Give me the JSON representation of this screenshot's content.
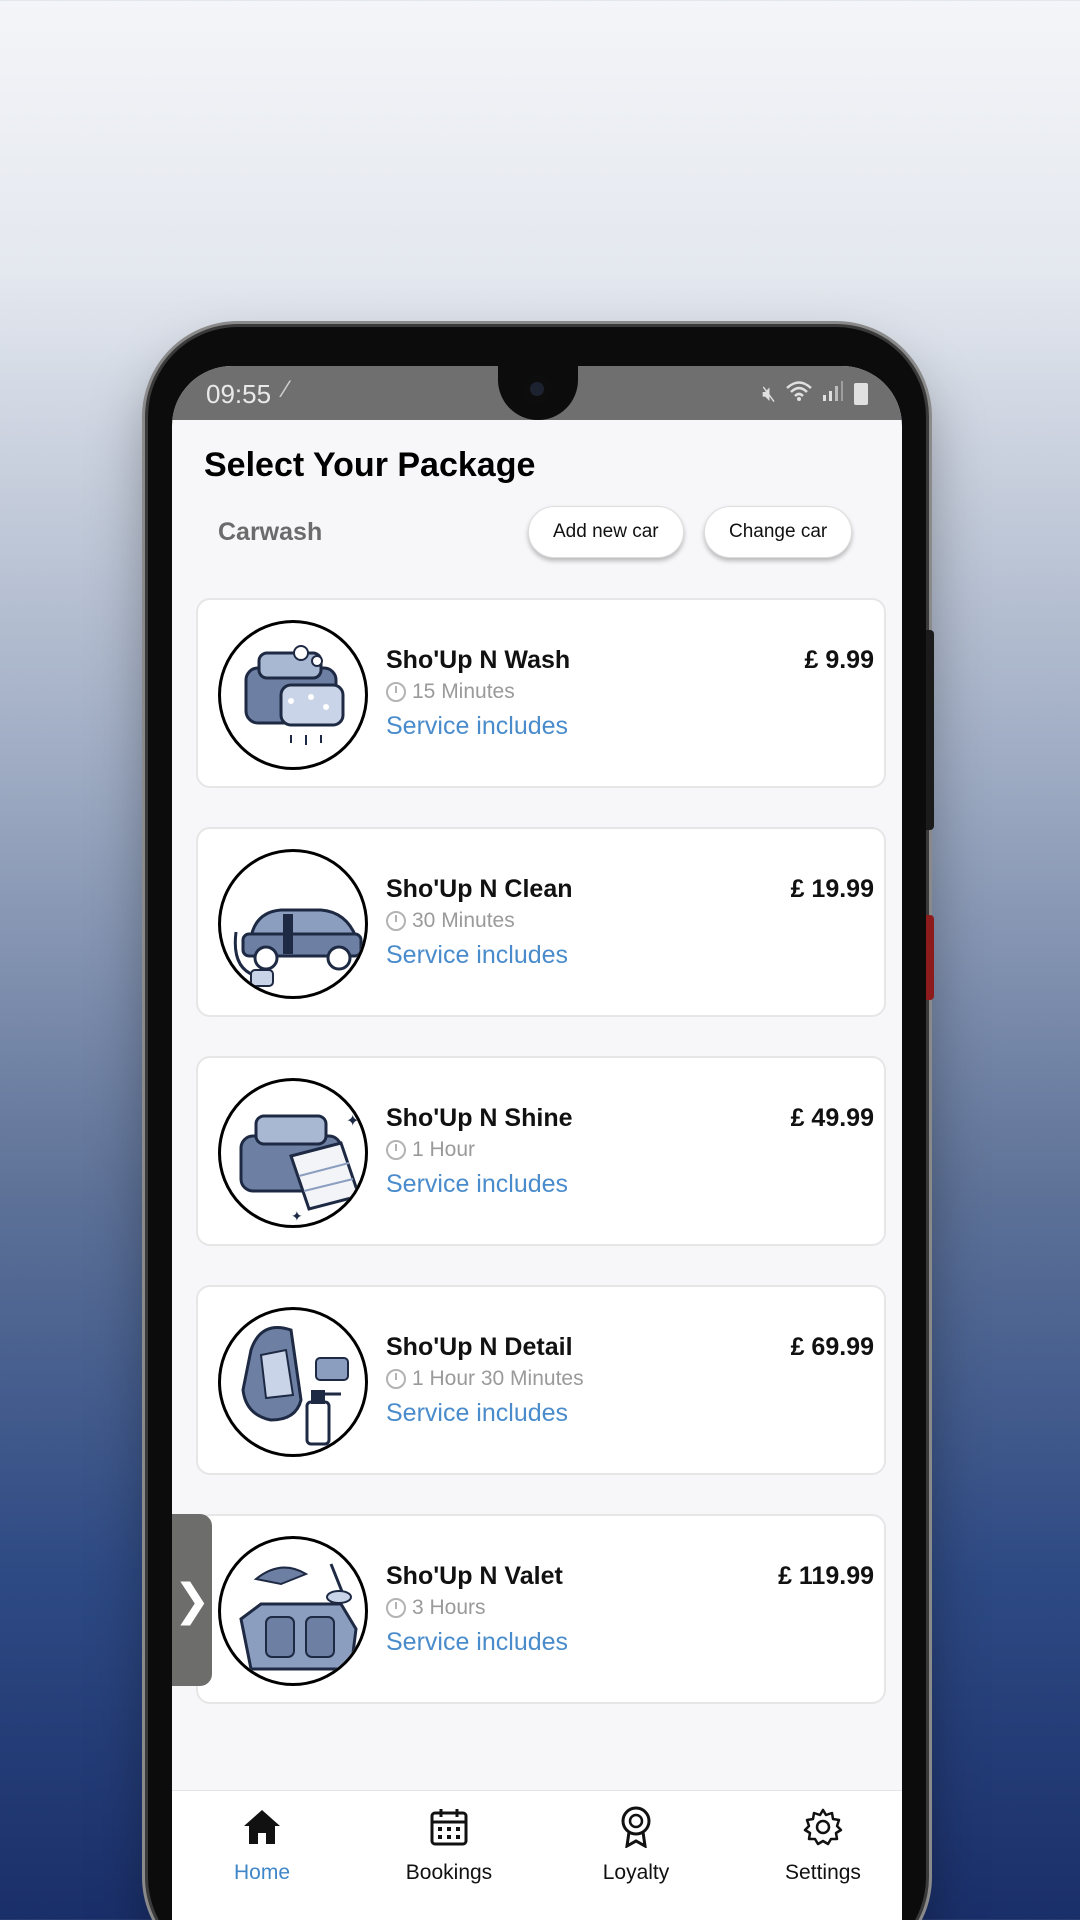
{
  "status_bar": {
    "time": "09:55"
  },
  "header": {
    "title": "Select Your Package"
  },
  "category": "Carwash",
  "buttons": {
    "add_car": "Add new car",
    "change_car": "Change car"
  },
  "packages": [
    {
      "name": "Sho'Up N Wash",
      "duration": "15 Minutes",
      "service_label": "Service includes",
      "price": "£ 9.99",
      "icon": "car-wash-sponge-icon"
    },
    {
      "name": "Sho'Up N Clean",
      "duration": "30 Minutes",
      "service_label": "Service includes",
      "price": "£ 19.99",
      "icon": "car-vacuum-icon"
    },
    {
      "name": "Sho'Up N Shine",
      "duration": "1 Hour",
      "service_label": "Service includes",
      "price": "£ 49.99",
      "icon": "car-polish-icon"
    },
    {
      "name": "Sho'Up N Detail",
      "duration": "1 Hour 30 Minutes",
      "service_label": "Service includes",
      "price": "£ 69.99",
      "icon": "car-seat-detail-icon"
    },
    {
      "name": "Sho'Up N Valet",
      "duration": "3 Hours",
      "service_label": "Service includes",
      "price": "£ 119.99",
      "icon": "car-interior-valet-icon"
    }
  ],
  "tabs": [
    {
      "label": "Home",
      "icon": "home-icon",
      "active": true
    },
    {
      "label": "Bookings",
      "icon": "calendar-icon",
      "active": false
    },
    {
      "label": "Loyalty",
      "icon": "award-icon",
      "active": false
    },
    {
      "label": "Settings",
      "icon": "gear-icon",
      "active": false
    }
  ],
  "colors": {
    "accent": "#3f86c8",
    "link": "#4a8ccb",
    "illustration": "#5b6f95"
  }
}
